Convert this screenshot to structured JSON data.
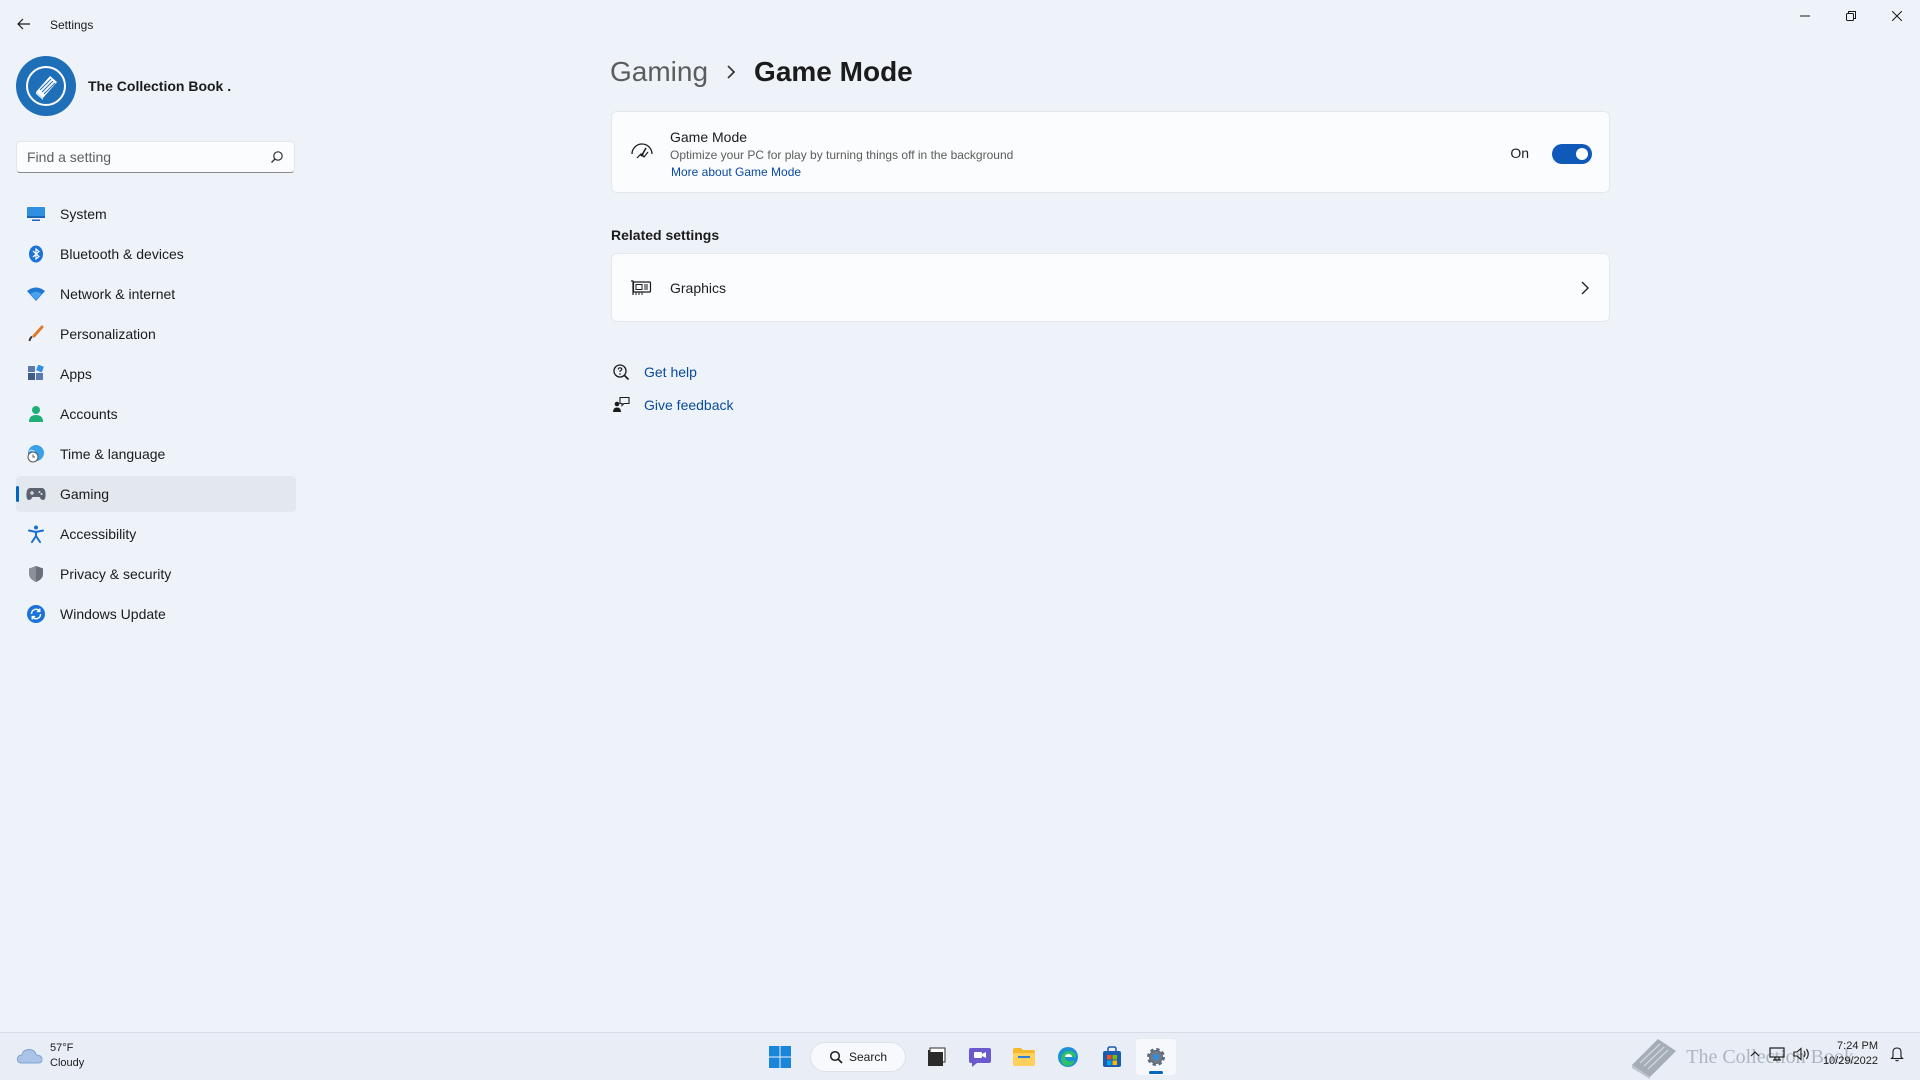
{
  "window": {
    "title": "Settings"
  },
  "profile": {
    "name": "The Collection Book ."
  },
  "search": {
    "placeholder": "Find a setting"
  },
  "sidebar": {
    "items": [
      {
        "label": "System",
        "icon": "monitor-icon"
      },
      {
        "label": "Bluetooth & devices",
        "icon": "bluetooth-icon"
      },
      {
        "label": "Network & internet",
        "icon": "wifi-icon"
      },
      {
        "label": "Personalization",
        "icon": "brush-icon"
      },
      {
        "label": "Apps",
        "icon": "apps-icon"
      },
      {
        "label": "Accounts",
        "icon": "person-icon"
      },
      {
        "label": "Time & language",
        "icon": "globe-clock-icon"
      },
      {
        "label": "Gaming",
        "icon": "gamepad-icon",
        "active": true
      },
      {
        "label": "Accessibility",
        "icon": "accessibility-icon"
      },
      {
        "label": "Privacy & security",
        "icon": "shield-icon"
      },
      {
        "label": "Windows Update",
        "icon": "update-icon"
      }
    ]
  },
  "breadcrumb": {
    "parent": "Gaming",
    "current": "Game Mode"
  },
  "game_mode": {
    "title": "Game Mode",
    "description": "Optimize your PC for play by turning things off in the background",
    "link": "More about Game Mode",
    "toggle_label": "On",
    "enabled": true
  },
  "related": {
    "title": "Related settings",
    "graphics_label": "Graphics"
  },
  "help": {
    "get_help": "Get help",
    "give_feedback": "Give feedback"
  },
  "taskbar": {
    "weather_temp": "57°F",
    "weather_desc": "Cloudy",
    "search_label": "Search",
    "time": "7:24 PM",
    "date": "10/29/2022",
    "watermark": "The Collection Book"
  },
  "colors": {
    "accent": "#0067c0",
    "toggle_on": "#0f5ab8",
    "link": "#0a4aa0"
  }
}
